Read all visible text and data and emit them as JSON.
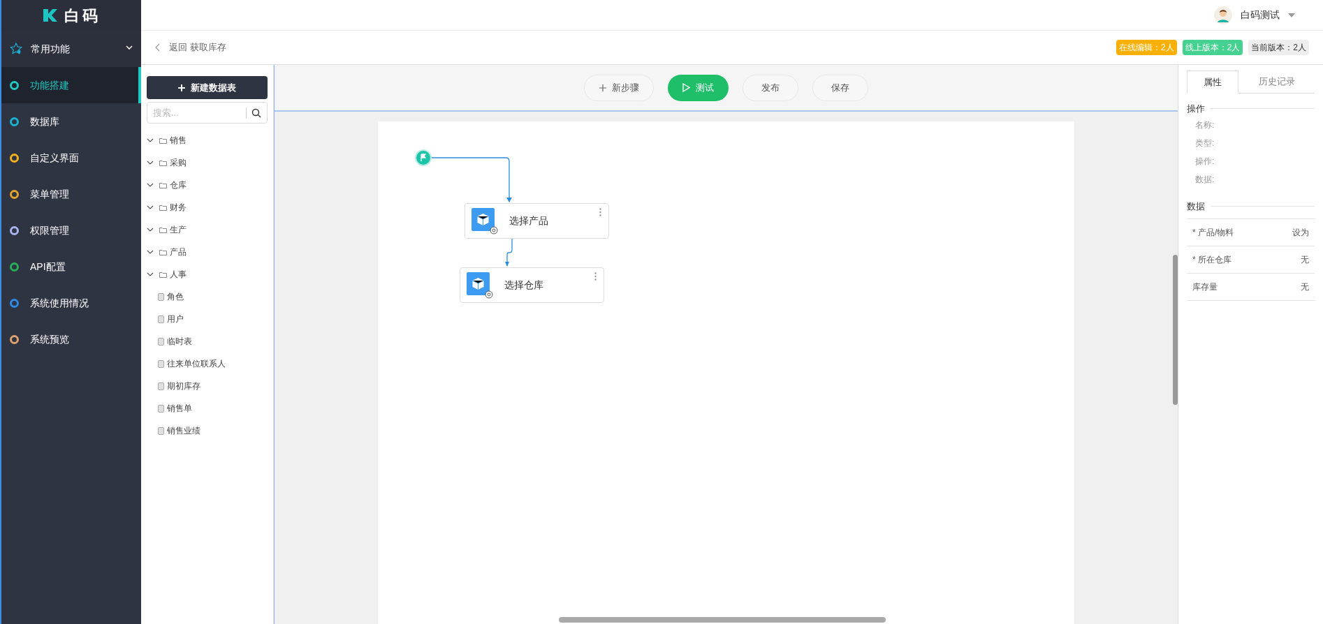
{
  "logo": {
    "text": "白码"
  },
  "user": {
    "name": "白码测试"
  },
  "sidebar": {
    "header": {
      "label": "常用功能",
      "expanded": true
    },
    "items": [
      {
        "label": "功能搭建",
        "color": "#1fc8c0",
        "selected": true
      },
      {
        "label": "数据库",
        "color": "#17b3cf",
        "selected": false
      },
      {
        "label": "自定义界面",
        "color": "#f5b01b",
        "selected": false
      },
      {
        "label": "菜单管理",
        "color": "#e3a22a",
        "selected": false
      },
      {
        "label": "权限管理",
        "color": "#a9b4f0",
        "selected": false
      },
      {
        "label": "API配置",
        "color": "#25b35a",
        "selected": false
      },
      {
        "label": "系统使用情况",
        "color": "#2d8ce8",
        "selected": false
      },
      {
        "label": "系统预览",
        "color": "#e0a070",
        "selected": false
      }
    ]
  },
  "breadcrumb": {
    "back": "返回",
    "title": "获取库存"
  },
  "badges": [
    {
      "text": "在线编辑：2人",
      "kind": "warning"
    },
    {
      "text": "线上版本：2人",
      "kind": "success"
    },
    {
      "text": "当前版本：2人",
      "kind": "plain"
    }
  ],
  "tables_panel": {
    "new_button": "新建数据表",
    "search": {
      "placeholder": "搜索..."
    },
    "tree": [
      {
        "label": "销售",
        "kind": "folder",
        "expanded": true
      },
      {
        "label": "采购",
        "kind": "folder",
        "expanded": true
      },
      {
        "label": "仓库",
        "kind": "folder",
        "expanded": true
      },
      {
        "label": "财务",
        "kind": "folder",
        "expanded": true
      },
      {
        "label": "生产",
        "kind": "folder",
        "expanded": true
      },
      {
        "label": "产品",
        "kind": "folder",
        "expanded": true
      },
      {
        "label": "人事",
        "kind": "folder",
        "expanded": true
      },
      {
        "label": "角色",
        "kind": "table"
      },
      {
        "label": "用户",
        "kind": "table"
      },
      {
        "label": "临时表",
        "kind": "table"
      },
      {
        "label": "往来单位联系人",
        "kind": "table"
      },
      {
        "label": "期初库存",
        "kind": "table"
      },
      {
        "label": "销售单",
        "kind": "table"
      },
      {
        "label": "销售业绩",
        "kind": "table"
      }
    ]
  },
  "toolbar": [
    {
      "label": "新步骤",
      "kind": "add"
    },
    {
      "label": "测试",
      "kind": "primary"
    },
    {
      "label": "发布",
      "kind": "plain"
    },
    {
      "label": "保存",
      "kind": "plain"
    }
  ],
  "flow": {
    "steps": [
      {
        "label": "选择产品"
      },
      {
        "label": "选择仓库"
      }
    ]
  },
  "properties": {
    "tabs": [
      {
        "label": "属性",
        "selected": true
      },
      {
        "label": "历史记录",
        "selected": false
      }
    ],
    "operation": {
      "title": "操作",
      "fields": [
        "名称:",
        "类型:",
        "操作:",
        "数据:"
      ]
    },
    "data": {
      "title": "数据",
      "rows": [
        {
          "label": "* 产品/物料",
          "value": "设为"
        },
        {
          "label": "* 所在仓库",
          "value": "无"
        },
        {
          "label": "库存量",
          "value": "无"
        }
      ]
    }
  }
}
